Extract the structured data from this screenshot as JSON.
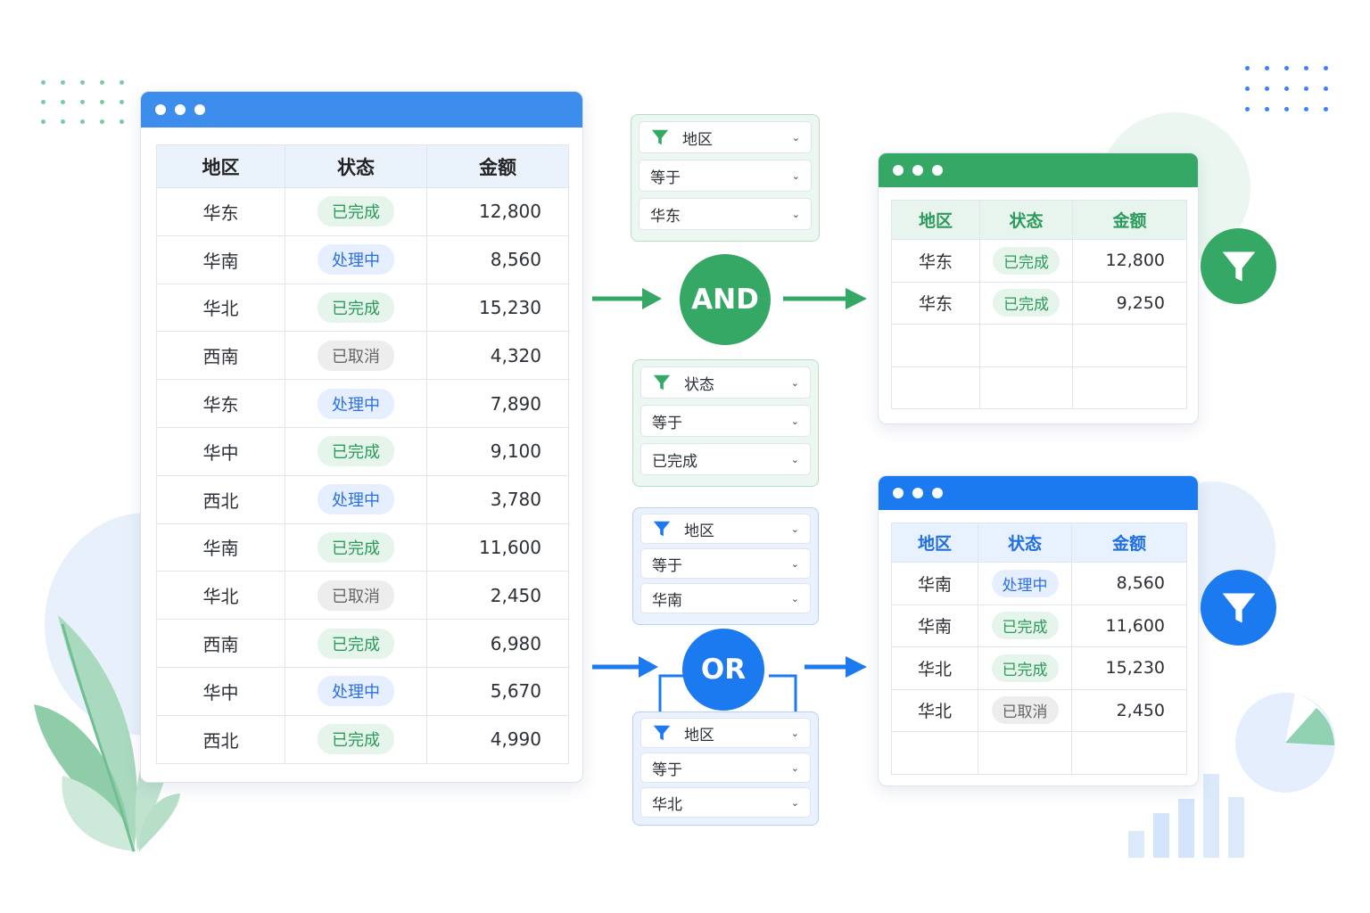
{
  "colors": {
    "green": "#35a865",
    "blue": "#1c7af0",
    "header_blue": "#3d8ded",
    "done_text": "#2c9a58",
    "processing_text": "#2a6ee8",
    "cancelled_text": "#666666"
  },
  "source_table": {
    "headers": [
      "地区",
      "状态",
      "金额"
    ],
    "rows": [
      {
        "region": "华东",
        "status": "已完成",
        "status_type": "done",
        "amount": "12,800"
      },
      {
        "region": "华南",
        "status": "处理中",
        "status_type": "proc",
        "amount": "8,560"
      },
      {
        "region": "华北",
        "status": "已完成",
        "status_type": "done",
        "amount": "15,230"
      },
      {
        "region": "西南",
        "status": "已取消",
        "status_type": "cancel",
        "amount": "4,320"
      },
      {
        "region": "华东",
        "status": "处理中",
        "status_type": "proc",
        "amount": "7,890"
      },
      {
        "region": "华中",
        "status": "已完成",
        "status_type": "done",
        "amount": "9,100"
      },
      {
        "region": "西北",
        "status": "处理中",
        "status_type": "proc",
        "amount": "3,780"
      },
      {
        "region": "华南",
        "status": "已完成",
        "status_type": "done",
        "amount": "11,600"
      },
      {
        "region": "华北",
        "status": "已取消",
        "status_type": "cancel",
        "amount": "2,450"
      },
      {
        "region": "西南",
        "status": "已完成",
        "status_type": "done",
        "amount": "6,980"
      },
      {
        "region": "华中",
        "status": "处理中",
        "status_type": "proc",
        "amount": "5,670"
      },
      {
        "region": "西北",
        "status": "已完成",
        "status_type": "done",
        "amount": "4,990"
      }
    ]
  },
  "and_group": {
    "operator": "AND",
    "filters": [
      {
        "field": "地区",
        "operator": "等于",
        "value": "华东"
      },
      {
        "field": "状态",
        "operator": "等于",
        "value": "已完成"
      }
    ]
  },
  "or_group": {
    "operator": "OR",
    "filters": [
      {
        "field": "地区",
        "operator": "等于",
        "value": "华南"
      },
      {
        "field": "地区",
        "operator": "等于",
        "value": "华北"
      }
    ]
  },
  "and_result": {
    "headers": [
      "地区",
      "状态",
      "金额"
    ],
    "rows": [
      {
        "region": "华东",
        "status": "已完成",
        "status_type": "done",
        "amount": "12,800"
      },
      {
        "region": "华东",
        "status": "已完成",
        "status_type": "done",
        "amount": "9,250"
      }
    ],
    "empty_rows": 2
  },
  "or_result": {
    "headers": [
      "地区",
      "状态",
      "金额"
    ],
    "rows": [
      {
        "region": "华南",
        "status": "处理中",
        "status_type": "proc",
        "amount": "8,560"
      },
      {
        "region": "华南",
        "status": "已完成",
        "status_type": "done",
        "amount": "11,600"
      },
      {
        "region": "华北",
        "status": "已完成",
        "status_type": "done",
        "amount": "15,230"
      },
      {
        "region": "华北",
        "status": "已取消",
        "status_type": "cancel",
        "amount": "2,450"
      }
    ],
    "empty_rows": 1
  },
  "icons": {
    "filter": "funnel-icon",
    "dropdown": "chevron-down-icon"
  }
}
